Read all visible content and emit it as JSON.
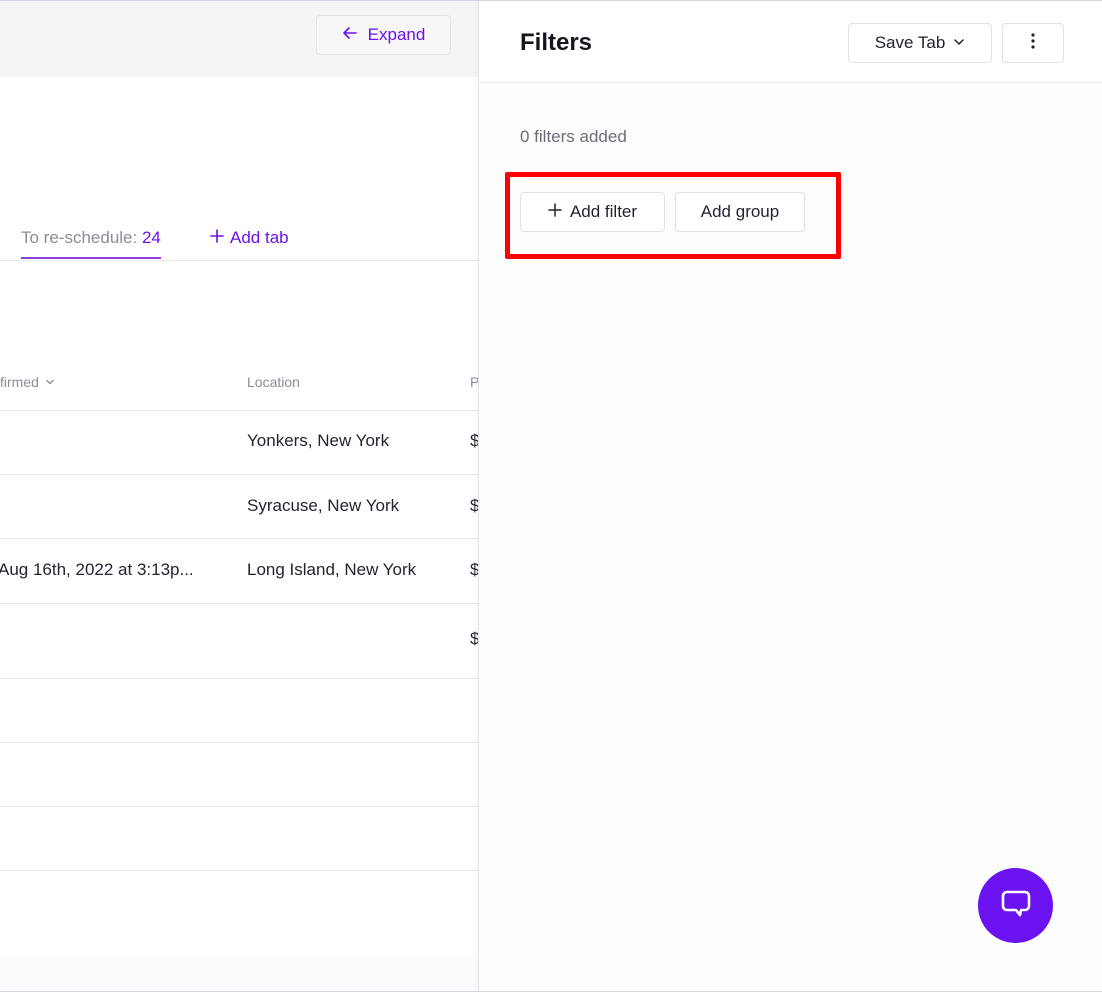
{
  "topbar": {
    "expand_label": "Expand"
  },
  "tabs": {
    "reschedule_label": "To re-schedule:",
    "reschedule_count": "24",
    "add_tab_label": "Add tab"
  },
  "table": {
    "headers": {
      "confirmed": "firmed",
      "location": "Location",
      "price_partial": "P"
    },
    "rows": [
      {
        "confirmed": "",
        "location": "Yonkers, New York",
        "price_partial": "$"
      },
      {
        "confirmed": "",
        "location": "Syracuse, New York",
        "price_partial": "$"
      },
      {
        "confirmed": "Aug 16th, 2022 at 3:13p...",
        "location": "Long Island, New York",
        "price_partial": "$"
      },
      {
        "confirmed": "",
        "location": "",
        "price_partial": "$"
      },
      {
        "confirmed": "",
        "location": "",
        "price_partial": ""
      },
      {
        "confirmed": "",
        "location": "",
        "price_partial": ""
      },
      {
        "confirmed": "",
        "location": "",
        "price_partial": ""
      }
    ]
  },
  "filters_panel": {
    "title": "Filters",
    "save_tab_label": "Save Tab",
    "filters_count_text": "0 filters added",
    "add_filter_label": "Add filter",
    "add_group_label": "Add group"
  },
  "colors": {
    "accent": "#6a12e8",
    "highlight": "#ff0000",
    "chat_fab": "#6a12f0"
  },
  "icons": [
    "arrow-left-icon",
    "plus-icon",
    "chevron-down-icon",
    "more-vertical-icon",
    "chat-bubble-icon"
  ]
}
